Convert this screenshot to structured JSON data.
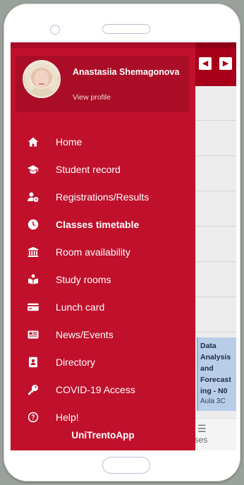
{
  "profile": {
    "name": "Anastasiia Shemagonova",
    "link": "View profile"
  },
  "menu": [
    {
      "label": "Home",
      "icon": "home-icon"
    },
    {
      "label": "Student record",
      "icon": "graduation-cap-icon"
    },
    {
      "label": "Registrations/Results",
      "icon": "user-clock-icon"
    },
    {
      "label": "Classes timetable",
      "icon": "clock-icon",
      "active": true
    },
    {
      "label": "Room availability",
      "icon": "university-building-icon"
    },
    {
      "label": "Study rooms",
      "icon": "reading-person-icon"
    },
    {
      "label": "Lunch card",
      "icon": "credit-card-icon"
    },
    {
      "label": "News/Events",
      "icon": "newspaper-icon"
    },
    {
      "label": "Directory",
      "icon": "address-book-icon"
    },
    {
      "label": "COVID-19 Access",
      "icon": "key-icon"
    },
    {
      "label": "Help!",
      "icon": "question-circle-icon"
    }
  ],
  "footer": "UniTrentoApp",
  "background": {
    "event": {
      "title": "Data Analysis and Forecasting - N0",
      "title_lines": [
        "Data",
        "Analysis",
        "and",
        "Forecast",
        "ing - N0"
      ],
      "room": "Aula 3C",
      "color": "#b8cde8"
    },
    "tab_label": "urses",
    "prev_arrow": "◀",
    "next_arrow": "▶"
  },
  "colors": {
    "drawer": "#c0102c",
    "profile_card": "#aa0e26",
    "topbar": "#a8001a"
  }
}
